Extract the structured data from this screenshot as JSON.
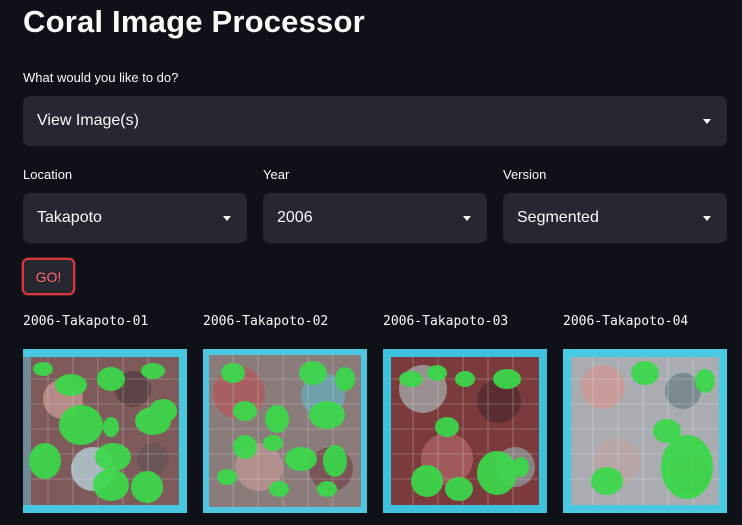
{
  "app_title": "Coral Image Processor",
  "action": {
    "label": "What would you like to do?",
    "selected": "View Image(s)"
  },
  "filters": {
    "location": {
      "label": "Location",
      "selected": "Takapoto"
    },
    "year": {
      "label": "Year",
      "selected": "2006"
    },
    "version": {
      "label": "Version",
      "selected": "Segmented"
    }
  },
  "go_button": "GO!",
  "images": [
    {
      "caption": "2006-Takapoto-01"
    },
    {
      "caption": "2006-Takapoto-02"
    },
    {
      "caption": "2006-Takapoto-03"
    },
    {
      "caption": "2006-Takapoto-04"
    }
  ],
  "colors": {
    "background": "#0e1117",
    "widget": "#262730",
    "button_border": "#d9363e",
    "segment": "#3ad94a"
  }
}
